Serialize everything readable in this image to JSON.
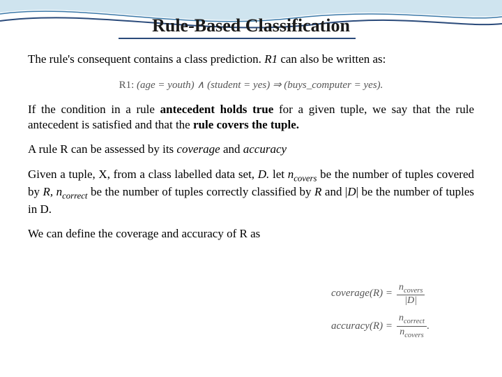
{
  "title": "Rule-Based Classification",
  "p1_a": "The rule's consequent contains a class prediction. ",
  "p1_b": "R1",
  "p1_c": " can also be written as:",
  "formula_prefix": "R1: ",
  "formula_body": "(age = youth) ∧ (student = yes) ⇒ (buys_computer = yes).",
  "p2_a": "If the condition in a rule ",
  "p2_b": "antecedent holds true",
  "p2_c": " for a given tuple, we say that the rule antecedent is satisfied and that the ",
  "p2_d": "rule covers the tuple.",
  "p3_a": "A rule R can be assessed by its ",
  "p3_b": "coverage",
  "p3_c": " and ",
  "p3_d": "accuracy",
  "p4_a": "Given a tuple, X, from a class labelled data set, ",
  "p4_b": "D.",
  "p4_c": " let ",
  "p4_d": "n",
  "p4_e": "covers",
  "p4_f": " be the number of tuples covered by ",
  "p4_g": "R, n",
  "p4_h": "correct",
  "p4_i": " be the number of tuples correctly classified by ",
  "p4_j": "R",
  "p4_k": " and |",
  "p4_l": "D",
  "p4_m": "| be the number of tuples in D.",
  "p5": "We can define the coverage and accuracy of R as",
  "eq1_lhs": "coverage(R) = ",
  "eq1_num": "n",
  "eq1_num_sub": "covers",
  "eq1_den": "|D|",
  "eq2_lhs": "accuracy(R) = ",
  "eq2_num": "n",
  "eq2_num_sub": "correct",
  "eq2_den": "n",
  "eq2_den_sub": "covers",
  "eq2_tail": "."
}
